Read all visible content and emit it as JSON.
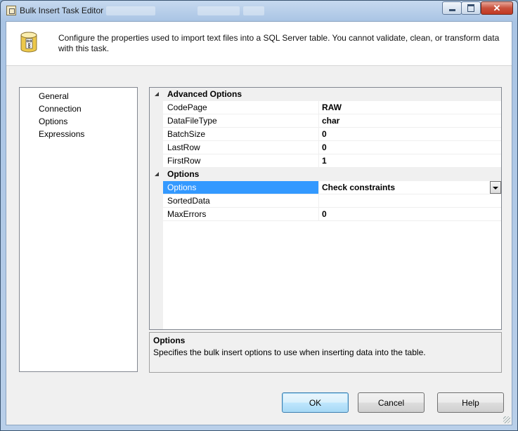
{
  "window": {
    "title": "Bulk Insert Task Editor",
    "close_glyph": "✕",
    "accent_color": "#3399ff"
  },
  "header": {
    "description": "Configure the properties used to import text files into a SQL Server table. You cannot validate, clean, or transform data with this task.",
    "icon": "database-icon"
  },
  "nav": {
    "items": [
      {
        "label": "General"
      },
      {
        "label": "Connection"
      },
      {
        "label": "Options",
        "selected": true
      },
      {
        "label": "Expressions"
      }
    ]
  },
  "properties": {
    "advanced": {
      "title": "Advanced Options",
      "rows": [
        {
          "name": "CodePage",
          "value": "RAW"
        },
        {
          "name": "DataFileType",
          "value": "char"
        },
        {
          "name": "BatchSize",
          "value": "0"
        },
        {
          "name": "LastRow",
          "value": "0"
        },
        {
          "name": "FirstRow",
          "value": "1"
        }
      ]
    },
    "options": {
      "title": "Options",
      "rows": [
        {
          "name": "Options",
          "value": "Check constraints",
          "selected": true
        },
        {
          "name": "SortedData",
          "value": ""
        },
        {
          "name": "MaxErrors",
          "value": "0"
        }
      ]
    }
  },
  "description_panel": {
    "title": "Options",
    "text": "Specifies the bulk insert options to use when inserting data into the table."
  },
  "buttons": {
    "ok": "OK",
    "cancel": "Cancel",
    "help": "Help"
  }
}
